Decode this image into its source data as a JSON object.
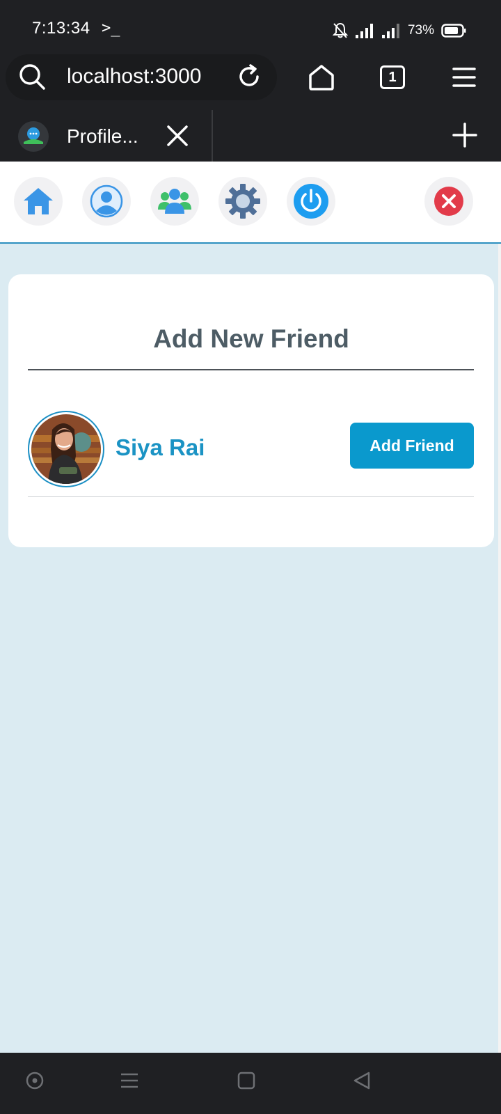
{
  "status_bar": {
    "time": "7:13:34",
    "terminal_glyph": ">_",
    "battery_percent": "73%",
    "icons": [
      "terminal-icon",
      "bell-off-icon",
      "signal-icon",
      "signal-icon",
      "battery-icon"
    ]
  },
  "browser": {
    "url": "localhost:3000",
    "tab_count": "1",
    "tab_title": "Profile...",
    "icons": [
      "search-icon",
      "reload-icon",
      "home-icon",
      "tabs-icon",
      "menu-icon",
      "close-tab-icon",
      "new-tab-icon"
    ]
  },
  "app_nav": {
    "items": [
      {
        "name": "home",
        "icon": "home-icon"
      },
      {
        "name": "profile",
        "icon": "user-icon"
      },
      {
        "name": "friends",
        "icon": "users-icon"
      },
      {
        "name": "settings",
        "icon": "gear-icon"
      },
      {
        "name": "logout",
        "icon": "power-icon"
      },
      {
        "name": "close",
        "icon": "close-circle-icon"
      }
    ]
  },
  "card": {
    "title": "Add New Friend",
    "friends": [
      {
        "name": "Siya Rai",
        "button_label": "Add Friend"
      }
    ]
  },
  "colors": {
    "accent": "#0a99cd",
    "page_bg": "#dbebf2",
    "title_text": "#4d5c65",
    "close_red": "#e23b4a"
  },
  "system_nav": {
    "icons": [
      "circle-icon",
      "recents-icon",
      "square-icon",
      "back-icon"
    ]
  }
}
